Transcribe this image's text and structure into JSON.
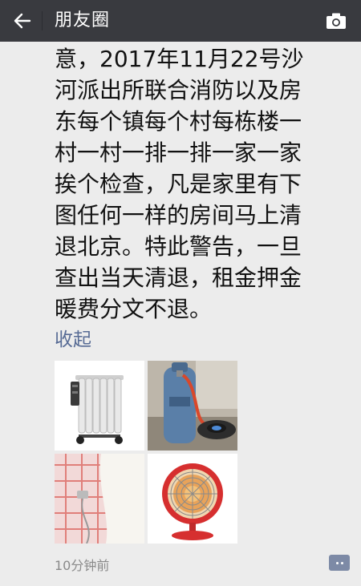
{
  "header": {
    "title": "朋友圈",
    "back_icon": "arrow-left-icon",
    "camera_icon": "camera-icon",
    "background": "#393a3f"
  },
  "post": {
    "lines": [
      "意，2017年11月22号沙",
      "河派出所联合消防以及房",
      "东每个镇每个村每栋楼一",
      "村一村一排一排一家一家",
      "挨个检查，凡是家里有下",
      "图任何一样的房间马上清",
      "退北京。特此警告，一旦",
      "查出当天清退，租金押金",
      "暖费分文不退。"
    ],
    "collapse_label": "收起",
    "link_color": "#576b95",
    "images": [
      {
        "name": "oil-radiator-heater"
      },
      {
        "name": "gas-cylinder-stove"
      },
      {
        "name": "electric-blanket"
      },
      {
        "name": "halogen-sun-heater"
      }
    ],
    "timestamp": "10分钟前",
    "comment_icon": "comment-dots-icon"
  }
}
